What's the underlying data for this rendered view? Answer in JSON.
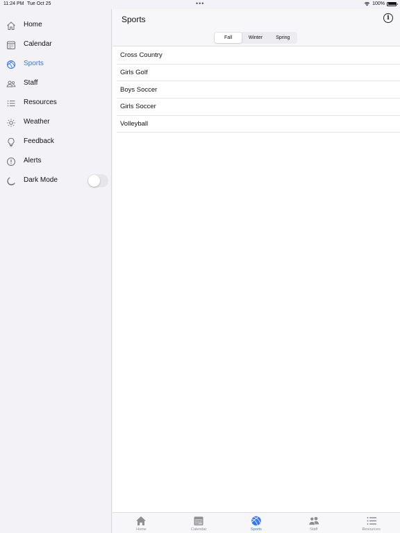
{
  "status_bar": {
    "time": "11:24 PM",
    "date": "Tue Oct 25",
    "dots": "•••",
    "battery": "100%",
    "battery_level": 1.0
  },
  "sidebar": {
    "items": [
      {
        "label": "Home",
        "icon": "house-icon"
      },
      {
        "label": "Calendar",
        "icon": "calendar-icon"
      },
      {
        "label": "Sports",
        "icon": "basketball-icon",
        "active": true
      },
      {
        "label": "Staff",
        "icon": "people-icon"
      },
      {
        "label": "Resources",
        "icon": "list-icon"
      },
      {
        "label": "Weather",
        "icon": "sun-icon"
      },
      {
        "label": "Feedback",
        "icon": "lightbulb-icon"
      },
      {
        "label": "Alerts",
        "icon": "exclamation-circle-icon"
      },
      {
        "label": "Dark Mode",
        "icon": "moon-icon",
        "toggle": false
      }
    ]
  },
  "main": {
    "title": "Sports",
    "info_icon": "info-circle-icon",
    "segments": [
      "Fall",
      "Winter",
      "Spring"
    ],
    "selected_segment": "Fall",
    "sports": [
      "Cross Country",
      "Girls Golf",
      "Boys Soccer",
      "Girls Soccer",
      "Volleyball"
    ]
  },
  "tab_bar": {
    "tabs": [
      {
        "label": "Home",
        "icon": "house-icon"
      },
      {
        "label": "Calendar",
        "icon": "calendar-icon"
      },
      {
        "label": "Sports",
        "icon": "basketball-icon",
        "active": true
      },
      {
        "label": "Staff",
        "icon": "people-icon"
      },
      {
        "label": "Resources",
        "icon": "list-icon"
      }
    ]
  },
  "colors": {
    "accent": "#3478f6",
    "inactive": "#8e8e93",
    "background": "#f2f2f7"
  }
}
